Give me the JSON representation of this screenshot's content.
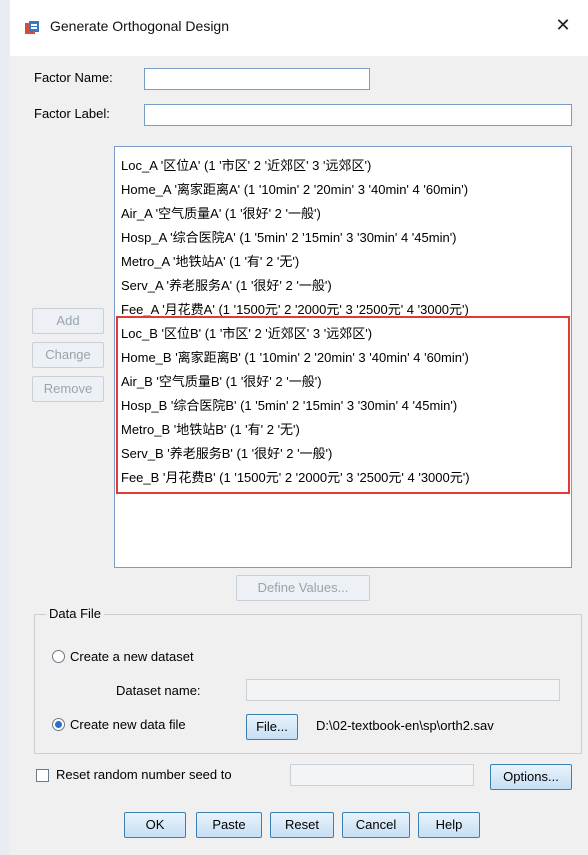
{
  "window": {
    "title": "Generate Orthogonal Design",
    "close": "✕"
  },
  "form": {
    "factor_name_label": "Factor Name:",
    "factor_label_label": "Factor Label:",
    "factor_name_value": "",
    "factor_label_value": ""
  },
  "factors": [
    "Loc_A '区位A' (1 '市区' 2 '近郊区' 3 '远郊区')",
    "Home_A '离家距离A' (1 '10min' 2 '20min' 3 '40min' 4 '60min')",
    "Air_A '空气质量A' (1 '很好' 2 '一般')",
    "Hosp_A '综合医院A' (1 '5min' 2 '15min' 3 '30min' 4 '45min')",
    "Metro_A '地铁站A' (1 '有' 2 '无')",
    "Serv_A '养老服务A' (1 '很好' 2 '一般')",
    "Fee_A '月花费A' (1 '1500元' 2 '2000元' 3 '2500元' 4 '3000元')",
    "Loc_B '区位B' (1 '市区' 2 '近郊区' 3 '远郊区')",
    "Home_B '离家距离B' (1 '10min' 2 '20min' 3 '40min' 4 '60min')",
    "Air_B '空气质量B' (1 '很好' 2 '一般')",
    "Hosp_B '综合医院B' (1 '5min' 2 '15min' 3 '30min' 4 '45min')",
    "Metro_B '地铁站B' (1 '有' 2 '无')",
    "Serv_B '养老服务B' (1 '很好' 2 '一般')",
    "Fee_B '月花费B' (1 '1500元' 2 '2000元' 3 '2500元' 4 '3000元')"
  ],
  "side_buttons": {
    "add": "Add",
    "change": "Change",
    "remove": "Remove"
  },
  "define_values": "Define Values...",
  "data_file": {
    "group_title": "Data File",
    "create_dataset": "Create a new dataset",
    "dataset_name_label": "Dataset name:",
    "dataset_name_value": "",
    "create_file": "Create new data file",
    "file_button": "File...",
    "file_path": "D:\\02-textbook-en\\sp\\orth2.sav",
    "selected": "create_file"
  },
  "seed": {
    "label": "Reset random number seed to",
    "value": "",
    "checked": false
  },
  "options_button": "Options...",
  "bottom_buttons": {
    "ok": "OK",
    "paste": "Paste",
    "reset": "Reset",
    "cancel": "Cancel",
    "help": "Help"
  },
  "colors": {
    "highlight": "#e53935",
    "accent": "#3c7fb1"
  }
}
